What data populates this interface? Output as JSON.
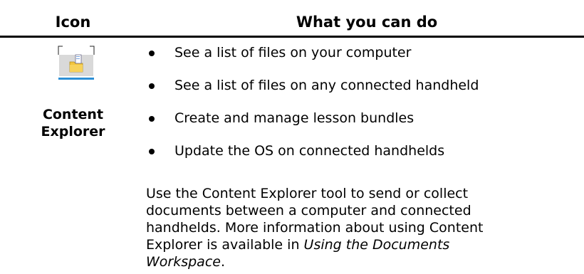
{
  "header": {
    "icon_label": "Icon",
    "what_label": "What you can do"
  },
  "tool": {
    "icon": "content-explorer-icon",
    "name_line1": "Content",
    "name_line2": "Explorer"
  },
  "bullets": [
    "See a list of files on your computer",
    "See a list of files on any connected handheld",
    "Create and manage lesson bundles",
    "Update the OS on connected handhelds"
  ],
  "description": {
    "text_before": "Use the Content Explorer tool to send or collect documents between a computer and connected handhelds. More information about using Content Explorer is available in ",
    "link_title": "Using the Documents Workspace",
    "text_after": "."
  }
}
